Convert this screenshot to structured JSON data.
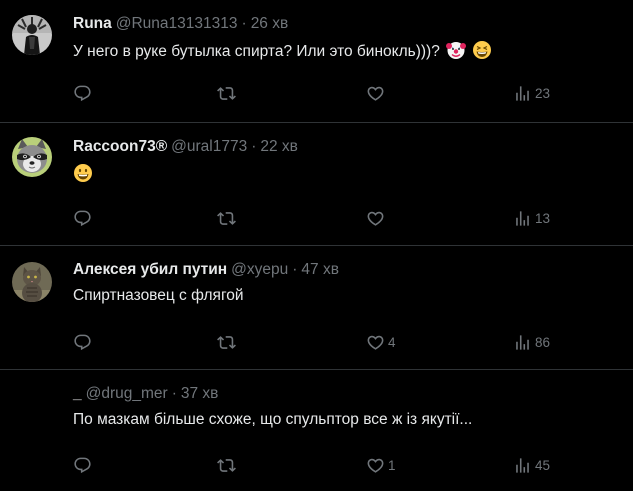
{
  "theme": {
    "background": "#000000",
    "text": "#e7e9ea",
    "muted": "#71767b",
    "divider": "#2f3336"
  },
  "replies": [
    {
      "display_name": "Runa",
      "handle": "@Runa13131313",
      "separator": "·",
      "time": "26 хв",
      "text": "У него в руке бутылка спирта? Или это бинокль)))?",
      "emojis": [
        "clown-face-emoji",
        "grinning-squinting-face-emoji"
      ],
      "avatar": "black-and-white-figure-avatar",
      "reply_count": "",
      "retweet_count": "",
      "like_count": "",
      "view_count": "23"
    },
    {
      "display_name": "Raccoon73®",
      "handle": "@ural1773",
      "separator": "·",
      "time": "22 хв",
      "text": "",
      "emojis": [
        "grinning-face-emoji"
      ],
      "avatar": "raccoon-avatar",
      "reply_count": "",
      "retweet_count": "",
      "like_count": "",
      "view_count": "13"
    },
    {
      "display_name": "Алексея убил путин",
      "handle": "@xyepu",
      "separator": "·",
      "time": "47 хв",
      "text": "Спиртназовец с флягой",
      "emojis": [],
      "avatar": "cat-avatar",
      "reply_count": "",
      "retweet_count": "",
      "like_count": "4",
      "view_count": "86"
    },
    {
      "display_name": "_",
      "handle": "@drug_mer",
      "separator": "·",
      "time": "37 хв",
      "text": "По мазкам більше схоже, що спульптор все ж із якутії...",
      "emojis": [],
      "avatar": "empty-avatar",
      "reply_count": "",
      "retweet_count": "",
      "like_count": "1",
      "view_count": "45"
    }
  ]
}
